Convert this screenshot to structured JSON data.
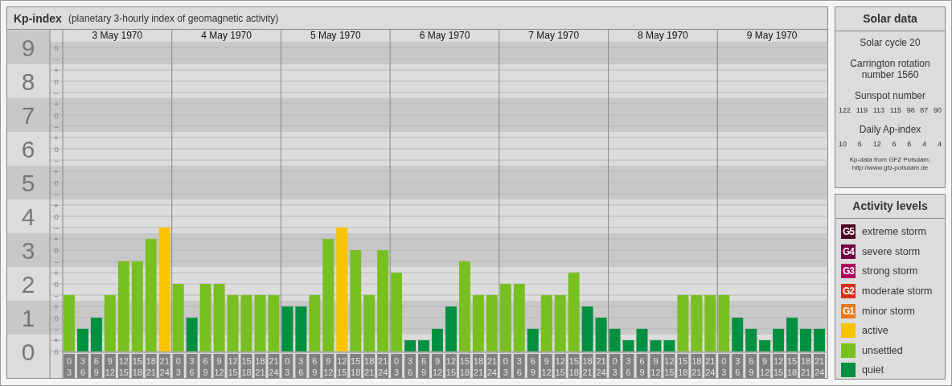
{
  "title": {
    "name": "Kp-index",
    "subtitle": "(planetary 3-hourly index of geomagnetic activity)"
  },
  "kp_chart": {
    "days": [
      "3 May 1970",
      "4 May 1970",
      "5 May 1970",
      "6 May 1970",
      "7 May 1970",
      "8 May 1970",
      "9 May 1970"
    ],
    "sublevel_marks": [
      "o",
      "–",
      "+",
      "o",
      "–",
      "+",
      "o",
      "–",
      "+",
      "o",
      "–",
      "+",
      "o",
      "–",
      "+",
      "o",
      "–",
      "+",
      "o",
      "–",
      "+",
      "o",
      "–",
      "+",
      "o",
      "–",
      "+",
      "o"
    ],
    "chart_data": {
      "type": "bar",
      "stacked": true,
      "grid": true,
      "ylim": [
        0,
        9
      ],
      "yticks": [
        {
          "value": 9,
          "label": "9"
        },
        {
          "value": 8,
          "label": "8"
        },
        {
          "value": 7,
          "label": "7"
        },
        {
          "value": 6,
          "label": "6"
        },
        {
          "value": 5,
          "label": "5"
        },
        {
          "value": 4,
          "label": "4"
        },
        {
          "value": 3,
          "label": "3"
        },
        {
          "value": 2,
          "label": "2"
        },
        {
          "value": 1,
          "label": "1"
        },
        {
          "value": 0,
          "label": "0"
        }
      ],
      "categories": [
        "0 3",
        "3 6",
        "6 9",
        "9 12",
        "12 15",
        "15 18",
        "18 21",
        "21 24",
        "0 3",
        "3 6",
        "6 9",
        "9 12",
        "12 15",
        "15 18",
        "18 21",
        "21 24",
        "0 3",
        "3 6",
        "6 9",
        "9 12",
        "12 15",
        "15 18",
        "18 21",
        "21 24",
        "0 3",
        "3 6",
        "6 9",
        "9 12",
        "12 15",
        "15 18",
        "18 21",
        "21 24",
        "0 3",
        "3 6",
        "6 9",
        "9 12",
        "12 15",
        "15 18",
        "18 21",
        "21 24",
        "0 3",
        "3 6",
        "6 9",
        "9 12",
        "12 15",
        "15 18",
        "18 21",
        "21 24",
        "0 3",
        "3 6",
        "6 9",
        "9 12",
        "12 15",
        "15 18",
        "18 21",
        "21 24"
      ],
      "series": [
        {
          "name": "quiet",
          "color": "#009040",
          "values": [
            null,
            0.67,
            1,
            null,
            null,
            null,
            null,
            null,
            null,
            1,
            null,
            null,
            null,
            null,
            null,
            null,
            1.33,
            1.33,
            null,
            null,
            null,
            null,
            null,
            null,
            null,
            0.33,
            0.33,
            0.67,
            1.33,
            null,
            null,
            null,
            null,
            null,
            0.67,
            null,
            null,
            null,
            1.33,
            1,
            0.67,
            0.33,
            0.67,
            0.33,
            0.33,
            null,
            null,
            null,
            null,
            1,
            0.67,
            0.33,
            0.67,
            1,
            0.67,
            0.67
          ]
        },
        {
          "name": "unsettled",
          "color": "#78c020",
          "values": [
            1.67,
            null,
            null,
            1.67,
            2.67,
            2.67,
            3.33,
            null,
            2,
            null,
            2,
            2,
            1.67,
            1.67,
            1.67,
            1.67,
            null,
            null,
            1.67,
            3.33,
            null,
            3,
            1.67,
            3,
            2.33,
            null,
            null,
            null,
            null,
            2.67,
            1.67,
            1.67,
            2,
            2,
            null,
            1.67,
            1.67,
            2.33,
            null,
            null,
            null,
            null,
            null,
            null,
            null,
            1.67,
            1.67,
            1.67,
            1.67,
            null,
            null,
            null,
            null,
            null,
            null,
            null
          ]
        },
        {
          "name": "active",
          "color": "#f8c400",
          "values": [
            null,
            null,
            null,
            null,
            null,
            null,
            null,
            3.67,
            null,
            null,
            null,
            null,
            null,
            null,
            null,
            null,
            null,
            null,
            null,
            null,
            3.67,
            null,
            null,
            null,
            null,
            null,
            null,
            null,
            null,
            null,
            null,
            null,
            null,
            null,
            null,
            null,
            null,
            null,
            null,
            null,
            null,
            null,
            null,
            null,
            null,
            null,
            null,
            null,
            null,
            null,
            null,
            null,
            null,
            null,
            null,
            null
          ]
        }
      ]
    }
  },
  "solar_data": {
    "title": "Solar data",
    "solar_cycle": "Solar cycle 20",
    "carrington": "Carrington rotation number 1560",
    "sunspot_label": "Sunspot number",
    "sunspot_numbers": [
      "122",
      "119",
      "113",
      "115",
      "98",
      "87",
      "90"
    ],
    "ap_label": "Daily Ap-index",
    "ap_values": [
      "10",
      "6",
      "12",
      "6",
      "6",
      "4",
      "4"
    ],
    "source": "Kp-data from GFZ Potsdam:",
    "source_url": "http://www.gfz-potsdam.de"
  },
  "activity_levels": {
    "title": "Activity levels",
    "items": [
      {
        "badge": "G5",
        "label": "extreme storm",
        "color": "#4c0024"
      },
      {
        "badge": "G4",
        "label": "severe storm",
        "color": "#700040"
      },
      {
        "badge": "G3",
        "label": "strong storm",
        "color": "#b00060"
      },
      {
        "badge": "G2",
        "label": "moderate storm",
        "color": "#d83018"
      },
      {
        "badge": "G1",
        "label": "minor storm",
        "color": "#e87818"
      }
    ]
  }
}
